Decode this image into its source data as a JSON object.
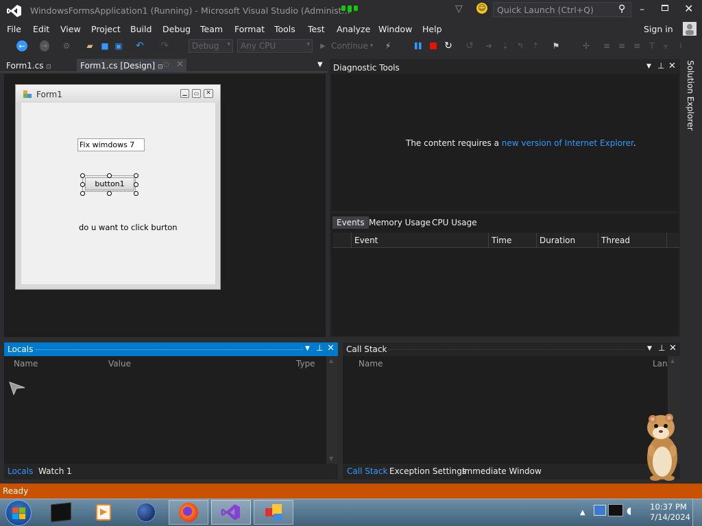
{
  "window": {
    "title": "WindowsFormsApplication1 (Running) - Microsoft Visual Studio (Administ...",
    "quick_launch_placeholder": "Quick Launch (Ctrl+Q)",
    "sign_in": "Sign in"
  },
  "menu": [
    "File",
    "Edit",
    "View",
    "Project",
    "Build",
    "Debug",
    "Team",
    "Format",
    "Tools",
    "Test",
    "Analyze",
    "Window",
    "Help"
  ],
  "toolbar": {
    "config": "Debug",
    "platform": "Any CPU",
    "continue": "Continue"
  },
  "doc_tabs": [
    {
      "label": "Form1.cs"
    },
    {
      "label": "Form1.cs [Design]"
    }
  ],
  "form": {
    "title": "Form1",
    "textbox_value": "Fix wimdows 7",
    "button_label": "button1",
    "label_text": "do u want to click burton"
  },
  "diagnostic": {
    "title": "Diagnostic Tools",
    "message_prefix": "The content requires a ",
    "message_link": "new version of Internet Explorer",
    "message_suffix": ".",
    "tabs": [
      "Events",
      "Memory Usage",
      "CPU Usage"
    ],
    "columns": [
      "Event",
      "Time",
      "Duration",
      "Thread"
    ]
  },
  "side_panel": {
    "label": "Solution Explorer"
  },
  "locals": {
    "title": "Locals",
    "columns": [
      "Name",
      "Value",
      "Type"
    ],
    "tabs": [
      "Locals",
      "Watch 1"
    ]
  },
  "callstack": {
    "title": "Call Stack",
    "columns": [
      "Name",
      "Lang"
    ],
    "tabs": [
      "Call Stack",
      "Exception Settings",
      "Immediate Window"
    ]
  },
  "status": {
    "text": "Ready"
  },
  "taskbar": {
    "time": "10:37 PM",
    "date": "7/14/2024"
  },
  "colors": {
    "accent": "#007acc",
    "status_bar": "#ca5100",
    "link": "#3399ff",
    "bg": "#2d2d30",
    "panel": "#1e1e1e"
  }
}
